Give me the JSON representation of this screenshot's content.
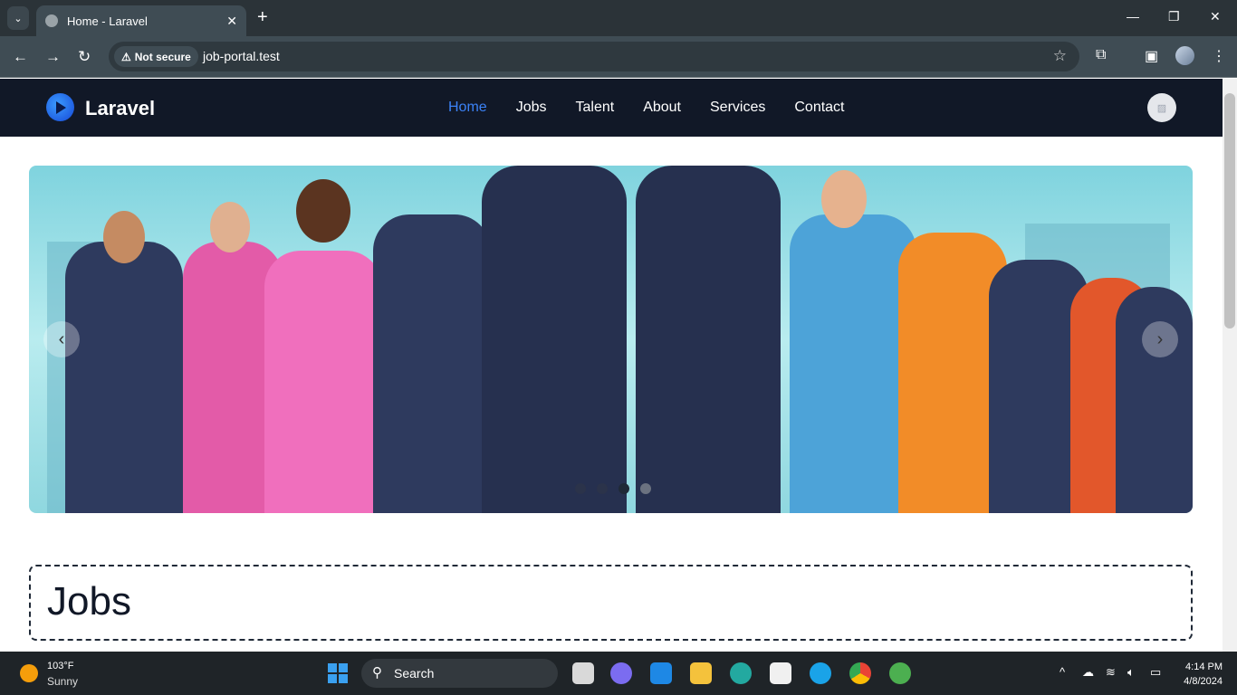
{
  "browser": {
    "tab_title": "Home - Laravel",
    "security": "Not secure",
    "url": "job-portal.test"
  },
  "site": {
    "brand": "Laravel",
    "nav": [
      {
        "label": "Home",
        "active": true
      },
      {
        "label": "Jobs"
      },
      {
        "label": "Talent"
      },
      {
        "label": "About"
      },
      {
        "label": "Services"
      },
      {
        "label": "Contact"
      }
    ],
    "accent": "#3b82f6"
  },
  "carousel": {
    "slides": 4,
    "active_index": 2
  },
  "section": {
    "title": "Jobs"
  },
  "taskbar": {
    "weather_temp": "103°F",
    "weather_desc": "Sunny",
    "search_label": "Search",
    "time": "4:14 PM",
    "date": "4/8/2024"
  }
}
